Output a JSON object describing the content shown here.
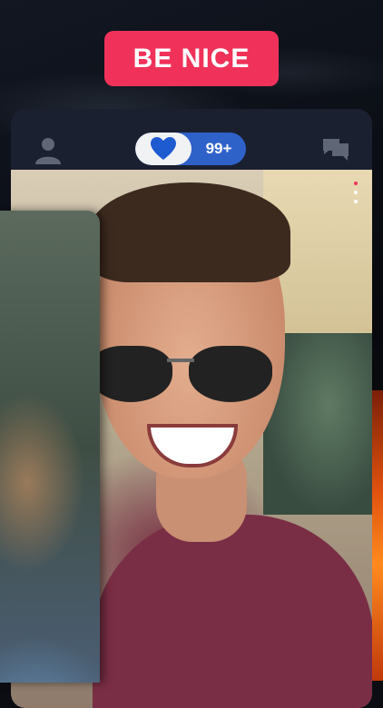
{
  "banner": {
    "text": "BE NICE"
  },
  "top_bar": {
    "profile_icon": "person-icon",
    "likes_icon": "heart-icon",
    "likes_count": "99+",
    "chat_icon": "chat-bubbles-icon"
  },
  "colors": {
    "accent": "#f0325a",
    "pill_blue": "#2f62c9",
    "heart_blue": "#1e5bd1",
    "panel": "#1b2030"
  },
  "photo_menu_dots": 3
}
